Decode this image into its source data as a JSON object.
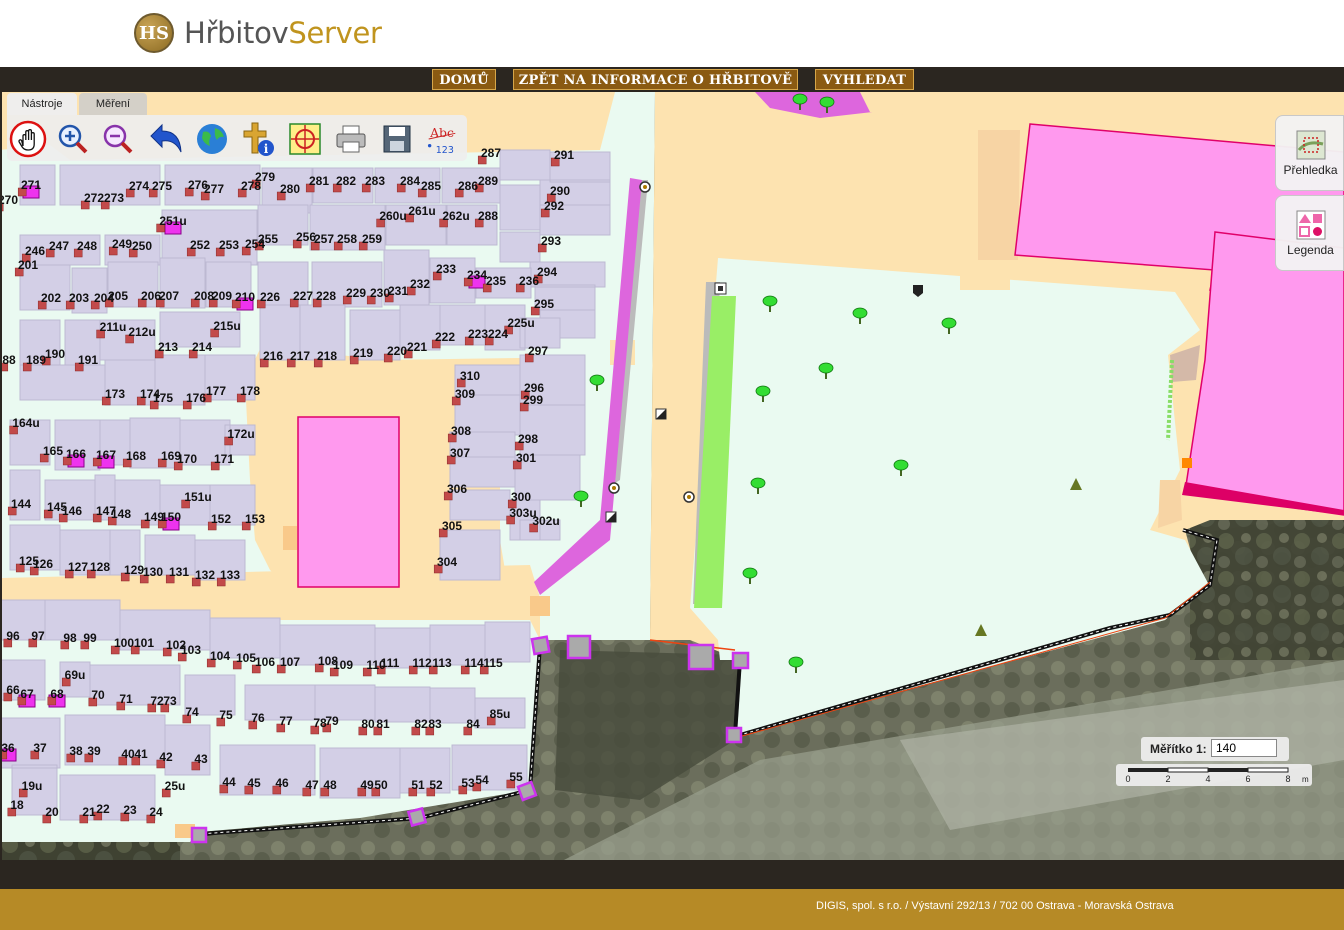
{
  "brand": {
    "name_part1": "Hřbitov",
    "name_part2": "Server",
    "logo_letters": "HS"
  },
  "nav": {
    "home": "DOMŮ",
    "back": "ZPĚT NA INFORMACE O HŘBITOVĚ",
    "search": "VYHLEDAT"
  },
  "tools": {
    "tabs": {
      "tools": "Nástroje",
      "measure": "Měření"
    },
    "buttons": [
      "pan-icon",
      "zoom-in-icon",
      "zoom-out-icon",
      "back-icon",
      "globe-icon",
      "grave-info-icon",
      "locate-icon",
      "print-icon",
      "save-icon",
      "label-icon"
    ],
    "label_icon_text": {
      "top": "Abc",
      "bottom": "123"
    }
  },
  "side_panels": {
    "overview": "Přehledka",
    "legend": "Legenda"
  },
  "scale": {
    "label": "Měřítko  1:",
    "value": "140",
    "ticks": [
      "0",
      "2",
      "4",
      "6",
      "8"
    ],
    "unit": "m"
  },
  "footer": {
    "text": "DIGIS, spol. s r.o. / Výstavní 292/13 / 702 00 Ostrava - Moravská Ostrava"
  },
  "colors": {
    "nav_bg": "#8a5a12",
    "footer_bg": "#b68a26",
    "plot": "#d3cfe6",
    "path": "#fde3b0",
    "lawn": "#eafaf1",
    "building": "#ff99ee",
    "grave": "#c24a4a"
  },
  "map": {
    "grave_labels": [
      [
        "271",
        31,
        184
      ],
      [
        "270",
        8,
        199
      ],
      [
        "272",
        94,
        197
      ],
      [
        "273",
        114,
        197
      ],
      [
        "274",
        139,
        185
      ],
      [
        "275",
        162,
        185
      ],
      [
        "276",
        198,
        184
      ],
      [
        "277",
        214,
        188
      ],
      [
        "278",
        251,
        185
      ],
      [
        "279",
        265,
        176
      ],
      [
        "280",
        290,
        188
      ],
      [
        "281",
        319,
        180
      ],
      [
        "282",
        346,
        180
      ],
      [
        "283",
        375,
        180
      ],
      [
        "284",
        410,
        180
      ],
      [
        "285",
        431,
        185
      ],
      [
        "286",
        468,
        185
      ],
      [
        "287",
        491,
        152
      ],
      [
        "289",
        488,
        180
      ],
      [
        "290",
        560,
        190
      ],
      [
        "291",
        564,
        154
      ],
      [
        "292",
        554,
        205
      ],
      [
        "251u",
        173,
        220
      ],
      [
        "260u",
        393,
        215
      ],
      [
        "261u",
        422,
        210
      ],
      [
        "262u",
        456,
        215
      ],
      [
        "288",
        488,
        215
      ],
      [
        "293",
        551,
        240
      ],
      [
        "246",
        35,
        250
      ],
      [
        "247",
        59,
        245
      ],
      [
        "248",
        87,
        245
      ],
      [
        "249",
        122,
        243
      ],
      [
        "250",
        142,
        245
      ],
      [
        "252",
        200,
        244
      ],
      [
        "253",
        229,
        244
      ],
      [
        "254",
        255,
        243
      ],
      [
        "255",
        268,
        238
      ],
      [
        "256",
        306,
        236
      ],
      [
        "257",
        324,
        238
      ],
      [
        "258",
        347,
        238
      ],
      [
        "259",
        372,
        238
      ],
      [
        "233",
        446,
        268
      ],
      [
        "234",
        477,
        274
      ],
      [
        "235",
        496,
        280
      ],
      [
        "236",
        529,
        280
      ],
      [
        "294",
        547,
        271
      ],
      [
        "201",
        28,
        264
      ],
      [
        "202",
        51,
        297
      ],
      [
        "203",
        79,
        297
      ],
      [
        "204",
        104,
        297
      ],
      [
        "205",
        118,
        295
      ],
      [
        "206",
        151,
        295
      ],
      [
        "207",
        169,
        295
      ],
      [
        "208",
        204,
        295
      ],
      [
        "209",
        222,
        295
      ],
      [
        "210",
        245,
        296
      ],
      [
        "226",
        270,
        296
      ],
      [
        "227",
        303,
        295
      ],
      [
        "228",
        326,
        295
      ],
      [
        "229",
        356,
        292
      ],
      [
        "230",
        380,
        292
      ],
      [
        "231",
        398,
        290
      ],
      [
        "232",
        420,
        283
      ],
      [
        "295",
        544,
        303
      ],
      [
        "211u",
        113,
        326
      ],
      [
        "212u",
        142,
        331
      ],
      [
        "215u",
        227,
        325
      ],
      [
        "225u",
        521,
        322
      ],
      [
        "213",
        168,
        346
      ],
      [
        "214",
        202,
        346
      ],
      [
        "222",
        445,
        336
      ],
      [
        "223",
        478,
        333
      ],
      [
        "224",
        498,
        333
      ],
      [
        "88",
        9,
        359
      ],
      [
        "189",
        36,
        359
      ],
      [
        "190",
        55,
        353
      ],
      [
        "191",
        88,
        359
      ],
      [
        "216",
        273,
        355
      ],
      [
        "217",
        300,
        355
      ],
      [
        "218",
        327,
        355
      ],
      [
        "219",
        363,
        352
      ],
      [
        "220",
        397,
        350
      ],
      [
        "221",
        417,
        346
      ],
      [
        "297",
        538,
        350
      ],
      [
        "310",
        470,
        375
      ],
      [
        "296",
        534,
        387
      ],
      [
        "173",
        115,
        393
      ],
      [
        "174",
        150,
        393
      ],
      [
        "175",
        163,
        397
      ],
      [
        "176",
        196,
        397
      ],
      [
        "177",
        216,
        390
      ],
      [
        "178",
        250,
        390
      ],
      [
        "309",
        465,
        393
      ],
      [
        "299",
        533,
        399
      ],
      [
        "164u",
        26,
        422
      ],
      [
        "172u",
        241,
        433
      ],
      [
        "308",
        461,
        430
      ],
      [
        "298",
        528,
        438
      ],
      [
        "165",
        53,
        450
      ],
      [
        "166",
        76,
        453
      ],
      [
        "167",
        106,
        454
      ],
      [
        "168",
        136,
        455
      ],
      [
        "169",
        171,
        455
      ],
      [
        "170",
        187,
        458
      ],
      [
        "171",
        224,
        458
      ],
      [
        "307",
        460,
        452
      ],
      [
        "301",
        526,
        457
      ],
      [
        "151u",
        198,
        496
      ],
      [
        "306",
        457,
        488
      ],
      [
        "300",
        521,
        496
      ],
      [
        "144",
        21,
        503
      ],
      [
        "145",
        57,
        506
      ],
      [
        "146",
        72,
        510
      ],
      [
        "147",
        106,
        510
      ],
      [
        "148",
        121,
        513
      ],
      [
        "149",
        154,
        516
      ],
      [
        "150",
        171,
        516
      ],
      [
        "152",
        221,
        518
      ],
      [
        "153",
        255,
        518
      ],
      [
        "303u",
        523,
        512
      ],
      [
        "302u",
        546,
        520
      ],
      [
        "305",
        452,
        525
      ],
      [
        "125",
        29,
        560
      ],
      [
        "126",
        43,
        563
      ],
      [
        "127",
        78,
        566
      ],
      [
        "128",
        100,
        566
      ],
      [
        "129",
        134,
        569
      ],
      [
        "130",
        153,
        571
      ],
      [
        "131",
        179,
        571
      ],
      [
        "132",
        205,
        574
      ],
      [
        "133",
        230,
        574
      ],
      [
        "304",
        447,
        561
      ],
      [
        "96",
        13,
        635
      ],
      [
        "97",
        38,
        635
      ],
      [
        "98",
        70,
        637
      ],
      [
        "99",
        90,
        637
      ],
      [
        "100",
        124,
        642
      ],
      [
        "101",
        144,
        642
      ],
      [
        "102",
        176,
        644
      ],
      [
        "103",
        191,
        649
      ],
      [
        "104",
        220,
        655
      ],
      [
        "105",
        246,
        657
      ],
      [
        "106",
        265,
        661
      ],
      [
        "107",
        290,
        661
      ],
      [
        "108",
        328,
        660
      ],
      [
        "109",
        343,
        664
      ],
      [
        "110",
        376,
        664
      ],
      [
        "111",
        390,
        662
      ],
      [
        "112",
        422,
        662
      ],
      [
        "113",
        442,
        662
      ],
      [
        "114",
        474,
        662
      ],
      [
        "115",
        493,
        662
      ],
      [
        "69u",
        75,
        674
      ],
      [
        "66",
        13,
        689
      ],
      [
        "67",
        27,
        693
      ],
      [
        "68",
        57,
        693
      ],
      [
        "70",
        98,
        694
      ],
      [
        "71",
        126,
        698
      ],
      [
        "72",
        157,
        700
      ],
      [
        "73",
        170,
        700
      ],
      [
        "74",
        192,
        711
      ],
      [
        "75",
        226,
        714
      ],
      [
        "76",
        258,
        717
      ],
      [
        "77",
        286,
        720
      ],
      [
        "78",
        320,
        722
      ],
      [
        "79",
        332,
        720
      ],
      [
        "80",
        368,
        723
      ],
      [
        "81",
        383,
        723
      ],
      [
        "82",
        421,
        723
      ],
      [
        "83",
        435,
        723
      ],
      [
        "84",
        473,
        723
      ],
      [
        "85u",
        500,
        713
      ],
      [
        "36",
        8,
        747
      ],
      [
        "37",
        40,
        747
      ],
      [
        "38",
        76,
        750
      ],
      [
        "39",
        94,
        750
      ],
      [
        "40",
        128,
        753
      ],
      [
        "41",
        141,
        753
      ],
      [
        "42",
        166,
        756
      ],
      [
        "43",
        201,
        758
      ],
      [
        "44",
        229,
        781
      ],
      [
        "45",
        254,
        782
      ],
      [
        "46",
        282,
        782
      ],
      [
        "47",
        312,
        784
      ],
      [
        "48",
        330,
        784
      ],
      [
        "49",
        367,
        784
      ],
      [
        "50",
        381,
        784
      ],
      [
        "51",
        418,
        784
      ],
      [
        "52",
        436,
        784
      ],
      [
        "53",
        468,
        782
      ],
      [
        "54",
        482,
        779
      ],
      [
        "55",
        516,
        776
      ],
      [
        "25u",
        175,
        785
      ],
      [
        "19u",
        32,
        785
      ],
      [
        "18",
        17,
        804
      ],
      [
        "20",
        52,
        811
      ],
      [
        "21",
        89,
        811
      ],
      [
        "22",
        103,
        808
      ],
      [
        "23",
        130,
        809
      ],
      [
        "24",
        156,
        811
      ]
    ]
  }
}
